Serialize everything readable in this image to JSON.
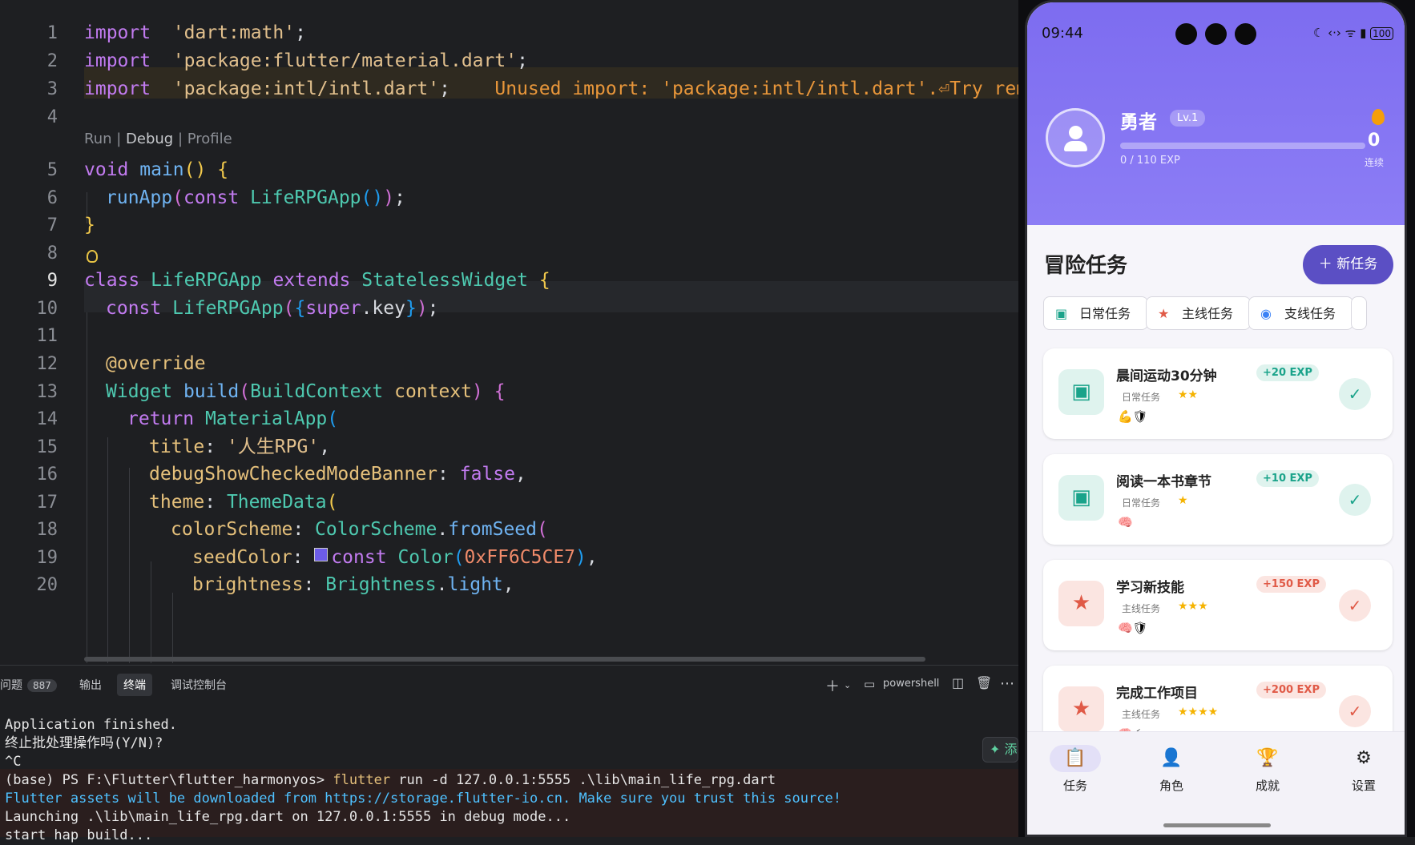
{
  "editor": {
    "codelens": {
      "run": "Run",
      "sep1": " | ",
      "debug": "Debug",
      "sep2": " | ",
      "profile": "Profile"
    },
    "lines": [
      {
        "n": "1",
        "parts": [
          [
            "kw",
            "import"
          ],
          [
            "",
            "  "
          ],
          [
            "str",
            "'dart:math'"
          ],
          [
            "",
            ";"
          ]
        ]
      },
      {
        "n": "2",
        "parts": [
          [
            "kw",
            "import"
          ],
          [
            "",
            "  "
          ],
          [
            "str",
            "'package:flutter/material.dart'"
          ],
          [
            "",
            ";"
          ]
        ]
      },
      {
        "n": "3",
        "parts": [
          [
            "kw",
            "import"
          ],
          [
            "",
            "  "
          ],
          [
            "str",
            "'package:intl/intl.dart'"
          ],
          [
            "",
            ";"
          ],
          [
            "",
            "    "
          ],
          [
            "warnmsg",
            "Unused import: 'package:intl/intl.dart'.⏎Try remov"
          ]
        ]
      },
      {
        "n": "4",
        "parts": []
      },
      {
        "n": "5",
        "parts": [
          [
            "kw",
            "void"
          ],
          [
            "",
            " "
          ],
          [
            "fn",
            "main"
          ],
          [
            "br1",
            "()"
          ],
          [
            "",
            " "
          ],
          [
            "br1",
            "{"
          ]
        ]
      },
      {
        "n": "6",
        "parts": [
          [
            "",
            ""
          ],
          [
            "fn",
            "runApp"
          ],
          [
            "br2",
            "("
          ],
          [
            "kw",
            "const"
          ],
          [
            "",
            " "
          ],
          [
            "cls",
            "LifeRPGApp"
          ],
          [
            "br3",
            "()"
          ],
          [
            "br2",
            ")"
          ],
          [
            "",
            ";"
          ]
        ]
      },
      {
        "n": "7",
        "parts": [
          [
            "br1",
            "}"
          ]
        ]
      },
      {
        "n": "8",
        "parts": []
      },
      {
        "n": "9",
        "parts": [
          [
            "kw",
            "class"
          ],
          [
            "",
            " "
          ],
          [
            "cls",
            "LifeRPGApp"
          ],
          [
            "",
            " "
          ],
          [
            "kw",
            "extends"
          ],
          [
            "",
            " "
          ],
          [
            "cls",
            "StatelessWidget"
          ],
          [
            "",
            " "
          ],
          [
            "br1",
            "{"
          ]
        ]
      },
      {
        "n": "10",
        "parts": [
          [
            "kw",
            "const"
          ],
          [
            "",
            " "
          ],
          [
            "cls",
            "LifeRPGApp"
          ],
          [
            "br2",
            "("
          ],
          [
            "br3",
            "{"
          ],
          [
            "kw",
            "super"
          ],
          [
            "",
            ".key"
          ],
          [
            "br3",
            "}"
          ],
          [
            "br2",
            ")"
          ],
          [
            "",
            ";"
          ]
        ]
      },
      {
        "n": "11",
        "parts": []
      },
      {
        "n": "12",
        "parts": [
          [
            "prm",
            "@override"
          ]
        ]
      },
      {
        "n": "13",
        "parts": [
          [
            "cls",
            "Widget"
          ],
          [
            "",
            " "
          ],
          [
            "fn",
            "build"
          ],
          [
            "br2",
            "("
          ],
          [
            "cls",
            "BuildContext"
          ],
          [
            "",
            " "
          ],
          [
            "prm",
            "context"
          ],
          [
            "br2",
            ")"
          ],
          [
            "",
            " "
          ],
          [
            "br2",
            "{"
          ]
        ]
      },
      {
        "n": "14",
        "parts": [
          [
            "kw",
            "return"
          ],
          [
            "",
            " "
          ],
          [
            "cls",
            "MaterialApp"
          ],
          [
            "br3",
            "("
          ]
        ]
      },
      {
        "n": "15",
        "parts": [
          [
            "prm",
            "title"
          ],
          [
            "",
            ": "
          ],
          [
            "str",
            "'人生RPG'"
          ],
          [
            "",
            ","
          ]
        ]
      },
      {
        "n": "16",
        "parts": [
          [
            "prm",
            "debugShowCheckedModeBanner"
          ],
          [
            "",
            ": "
          ],
          [
            "kw",
            "false"
          ],
          [
            "",
            ","
          ]
        ]
      },
      {
        "n": "17",
        "parts": [
          [
            "prm",
            "theme"
          ],
          [
            "",
            ": "
          ],
          [
            "cls",
            "ThemeData"
          ],
          [
            "br1",
            "("
          ]
        ]
      },
      {
        "n": "18",
        "parts": [
          [
            "prm",
            "colorScheme"
          ],
          [
            "",
            ": "
          ],
          [
            "cls",
            "ColorScheme"
          ],
          [
            "",
            "."
          ],
          [
            "fn",
            "fromSeed"
          ],
          [
            "br2",
            "("
          ]
        ]
      },
      {
        "n": "19",
        "parts": [
          [
            "prm",
            "seedColor"
          ],
          [
            "",
            ": "
          ],
          [
            "swatch",
            ""
          ],
          [
            "kw",
            "const"
          ],
          [
            "",
            " "
          ],
          [
            "cls",
            "Color"
          ],
          [
            "br3",
            "("
          ],
          [
            "num",
            "0xFF6C5CE7"
          ],
          [
            "br3",
            ")"
          ],
          [
            "",
            ","
          ]
        ]
      },
      {
        "n": "20",
        "parts": [
          [
            "prm",
            "brightness"
          ],
          [
            "",
            ": "
          ],
          [
            "cls",
            "Brightness"
          ],
          [
            "",
            "."
          ],
          [
            "fn",
            "light"
          ],
          [
            "",
            ","
          ]
        ]
      }
    ]
  },
  "panel": {
    "tabs": [
      {
        "label": "问题",
        "badge": "887"
      },
      {
        "label": "输出"
      },
      {
        "label": "终端",
        "active": true
      },
      {
        "label": "调试控制台"
      }
    ],
    "shell": "powershell",
    "add_label": "添",
    "terminal": {
      "line1": "Application finished.",
      "line2": "终止批处理操作吗(Y/N)?",
      "line3": "^C",
      "prompt": "(base) PS F:\\Flutter\\flutter_harmonyos> ",
      "cmd": "flutter",
      "cmd_args": " run -d 127.0.0.1:5555 .\\lib\\main_life_rpg.dart",
      "line5": "Flutter assets will be downloaded from https://storage.flutter-io.cn. Make sure you trust this source!",
      "line6": "Launching .\\lib\\main_life_rpg.dart on 127.0.0.1:5555 in debug mode...",
      "line7": "start hap build..."
    }
  },
  "phone": {
    "time": "09:44",
    "battery": "100",
    "profile": {
      "name": "勇者",
      "level": "Lv.1",
      "exp_text": "0 / 110 EXP",
      "exp_fraction": 0,
      "streak": "0",
      "streak_label": "连续"
    },
    "section_title": "冒险任务",
    "new_task": "新任务",
    "filters": [
      {
        "label": "日常任务",
        "icon": "calendar-icon",
        "color": "#1aa38a"
      },
      {
        "label": "主线任务",
        "icon": "star-icon",
        "color": "#e05a47"
      },
      {
        "label": "支线任务",
        "icon": "compass-icon",
        "color": "#3b82f6"
      }
    ],
    "quests": [
      {
        "title": "晨间运动30分钟",
        "category": "日常任务",
        "stars": "★★",
        "attrs": "💪🛡",
        "exp": "+20 EXP",
        "kind": "daily"
      },
      {
        "title": "阅读一本书章节",
        "category": "日常任务",
        "stars": "★",
        "attrs": "🧠",
        "exp": "+10 EXP",
        "kind": "daily"
      },
      {
        "title": "学习新技能",
        "category": "主线任务",
        "stars": "★★★",
        "attrs": "🧠🛡",
        "exp": "+150 EXP",
        "kind": "main"
      },
      {
        "title": "完成工作项目",
        "category": "主线任务",
        "stars": "★★★★",
        "attrs": "🧠⚡",
        "exp": "+200 EXP",
        "kind": "main"
      }
    ],
    "nav": [
      {
        "label": "任务",
        "icon": "clipboard-icon",
        "active": true
      },
      {
        "label": "角色",
        "icon": "person-icon"
      },
      {
        "label": "成就",
        "icon": "trophy-icon"
      },
      {
        "label": "设置",
        "icon": "gear-icon"
      }
    ],
    "colors": {
      "accent": "#6C5CE7",
      "daily": "#1aa38a",
      "main": "#e05a47"
    }
  }
}
